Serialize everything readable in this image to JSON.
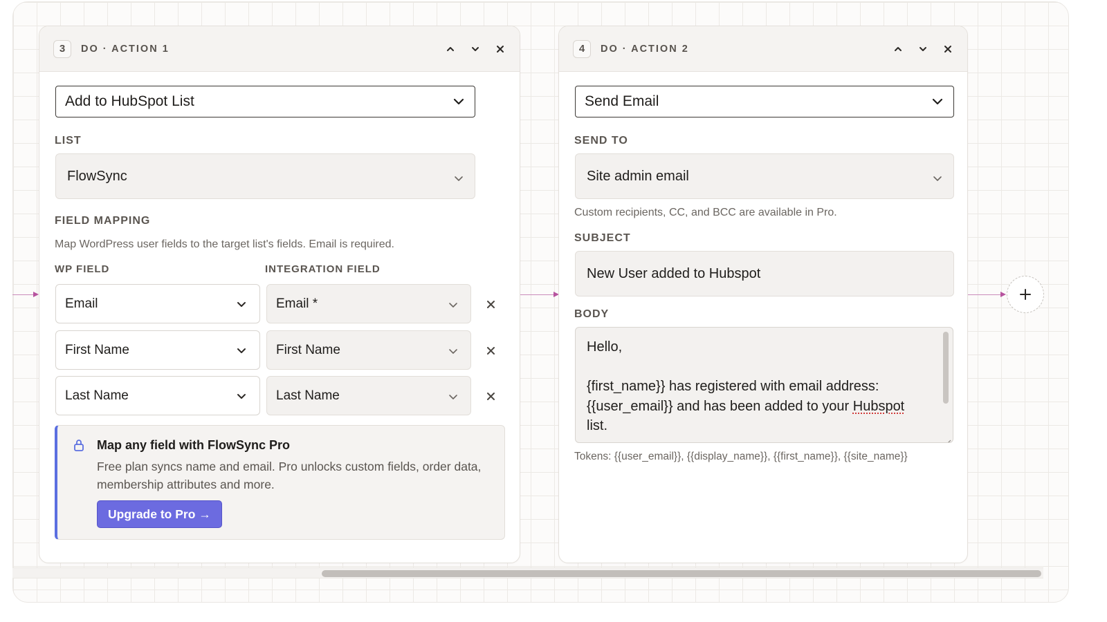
{
  "colors": {
    "accent": "#6c6be0",
    "pro_border": "#5b6fe0",
    "connector": "#b7549f",
    "grid": "#ece9e5"
  },
  "action1": {
    "step": "3",
    "title": "DO · ACTION 1",
    "action_select": "Add to HubSpot List",
    "list_label": "LIST",
    "list_value": "FlowSync",
    "mapping_label": "FIELD MAPPING",
    "mapping_help": "Map WordPress user fields to the target list's fields. Email is required.",
    "wp_field_header": "WP FIELD",
    "integration_field_header": "INTEGRATION FIELD",
    "rows": [
      {
        "wp": "Email",
        "integration": "Email *"
      },
      {
        "wp": "First Name",
        "integration": "First Name"
      },
      {
        "wp": "Last Name",
        "integration": "Last Name"
      }
    ],
    "pro": {
      "title": "Map any field with FlowSync Pro",
      "desc": "Free plan syncs name and email. Pro unlocks custom fields, order data, membership attributes and more.",
      "button": "Upgrade to Pro →"
    }
  },
  "action2": {
    "step": "4",
    "title": "DO · ACTION 2",
    "action_select": "Send Email",
    "send_to_label": "SEND TO",
    "send_to_value": "Site admin email",
    "send_to_help": "Custom recipients, CC, and BCC are available in Pro.",
    "subject_label": "SUBJECT",
    "subject_value": "New User added to Hubspot",
    "body_label": "BODY",
    "body_lines": {
      "l1": "Hello,",
      "l2": "",
      "l3": "{first_name}} has registered with email address:",
      "l4a": "{{user_email}} and has been added to your ",
      "l4b": "Hubspot",
      "l5": "list."
    },
    "tokens": "Tokens: {{user_email}}, {{display_name}}, {{first_name}}, {{site_name}}"
  },
  "icons": {
    "move_up": "chevron-up-icon",
    "move_down": "chevron-down-icon",
    "close": "close-icon",
    "lock": "lock-icon",
    "add": "plus-icon"
  }
}
